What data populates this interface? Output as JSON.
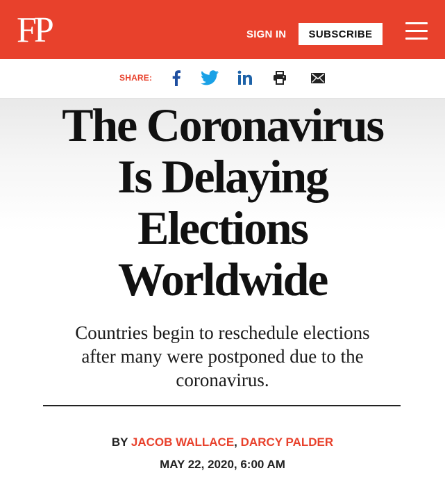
{
  "header": {
    "logo": "FP",
    "sign_in": "SIGN IN",
    "subscribe": "SUBSCRIBE",
    "accent_color": "#e8412c"
  },
  "share": {
    "label": "SHARE:",
    "icons": [
      "facebook-icon",
      "twitter-icon",
      "linkedin-icon",
      "print-icon",
      "email-icon"
    ]
  },
  "article": {
    "headline_lines": [
      "The Coronavirus",
      "Is Delaying",
      "Elections",
      "Worldwide"
    ],
    "dek_lines": [
      "Countries begin to reschedule elections",
      "after many were postponed due to the",
      "coronavirus."
    ],
    "byline_prefix": "BY",
    "authors": [
      "JACOB WALLACE",
      "DARCY PALDER"
    ],
    "author_separator": ",",
    "date": "MAY 22, 2020, 6:00 AM"
  }
}
